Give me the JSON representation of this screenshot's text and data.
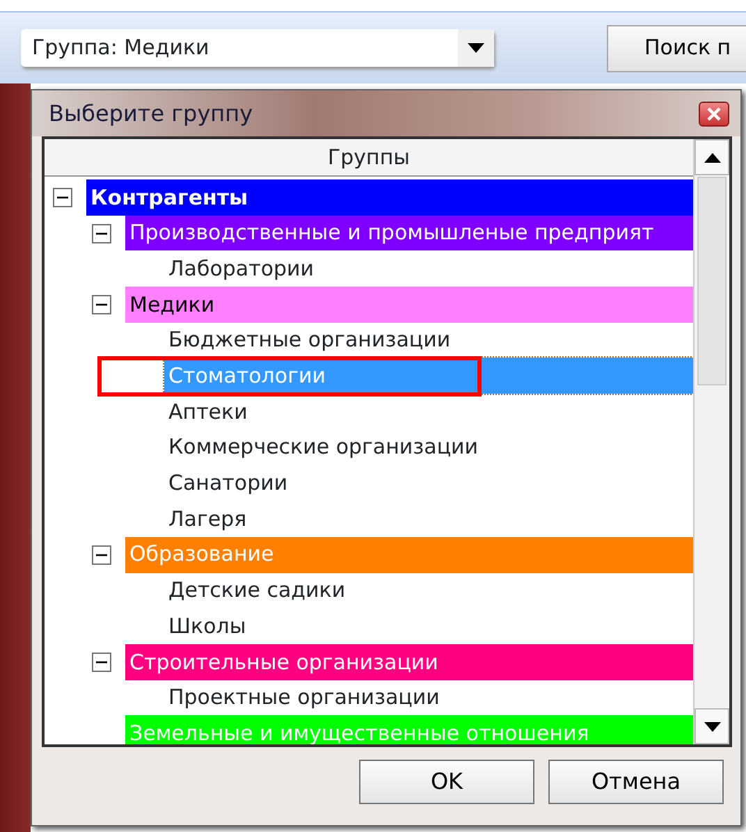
{
  "toolbar": {
    "group_combo": {
      "value": "Группа:  Медики"
    },
    "search_button": {
      "label": "Поиск п"
    }
  },
  "dialog": {
    "title": "Выберите группу",
    "tree": {
      "header": "Группы",
      "items": [
        {
          "label": "Контрагенты",
          "color": "#0000ff",
          "light_text": true,
          "bold": true,
          "expanded": true,
          "selected": false,
          "children": [
            {
              "label": "Производственные и промышленые предприят",
              "color": "#8000ff",
              "light_text": true,
              "expanded": true,
              "selected": false,
              "children": [
                {
                  "label": "Лаборатории",
                  "selected": false
                }
              ]
            },
            {
              "label": "Медики",
              "color": "#ff80ff",
              "light_text": false,
              "expanded": true,
              "selected": false,
              "children": [
                {
                  "label": "Бюджетные организации",
                  "selected": false
                },
                {
                  "label": "Стоматологии",
                  "selected": true,
                  "highlighted": true
                },
                {
                  "label": "Аптеки",
                  "selected": false
                },
                {
                  "label": "Коммерческие организации",
                  "selected": false
                },
                {
                  "label": "Санатории",
                  "selected": false
                },
                {
                  "label": "Лагеря",
                  "selected": false
                }
              ]
            },
            {
              "label": "Образование",
              "color": "#ff8000",
              "light_text": true,
              "expanded": true,
              "selected": false,
              "children": [
                {
                  "label": "Детские садики",
                  "selected": false
                },
                {
                  "label": "Школы",
                  "selected": false
                }
              ]
            },
            {
              "label": "Строительные организации",
              "color": "#ff0080",
              "light_text": true,
              "expanded": true,
              "selected": false,
              "children": [
                {
                  "label": "Проектные организации",
                  "selected": false
                }
              ]
            },
            {
              "label": "Земельные и имущественные отношения",
              "color": "#00ff00",
              "light_text": true,
              "selected": false
            }
          ]
        }
      ]
    },
    "buttons": [
      {
        "label": "OK"
      },
      {
        "label": "Отмена"
      }
    ]
  }
}
